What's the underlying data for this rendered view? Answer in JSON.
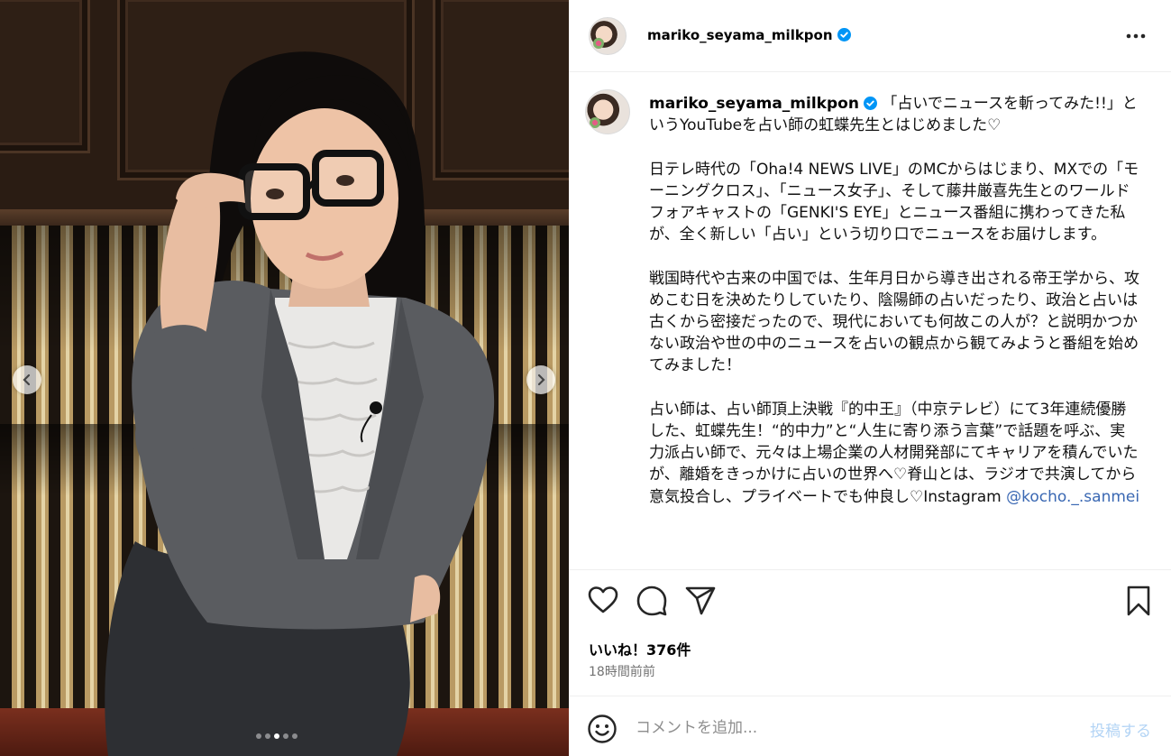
{
  "post": {
    "username": "mariko_seyama_milkpon",
    "verified": true,
    "caption_paragraphs": [
      "「占いでニュースを斬ってみた!!」というYouTubeを占い師の虹蝶先生とはじめました♡",
      "日テレ時代の「Oha!4 NEWS LIVE」のMCからはじまり、MXでの「モーニングクロス」、「ニュース女子」、そして藤井厳喜先生とのワールドフォアキャストの「GENKI'S EYE」とニュース番組に携わってきた私が、全く新しい「占い」という切り口でニュースをお届けします。",
      "戦国時代や古来の中国では、生年月日から導き出される帝王学から、攻めこむ日を決めたりしていたり、陰陽師の占いだったり、政治と占いは古くから密接だったので、現代においても何故この人が？と説明かつかない政治や世の中のニュースを占いの観点から観てみようと番組を始めてみました！",
      "占い師は、占い師頂上決戦『的中王』（中京テレビ）にて3年連続優勝した、虹蝶先生！“的中力”と“人生に寄り添う言葉”で話題を呼ぶ、実力派占い師で、元々は上場企業の人材開発部にてキャリアを積んでいたが、離婚をきっかけに占いの世界へ♡脊山とは、ラジオで共演してから意気投合し、プライベートでも仲良し♡Instagram "
    ],
    "mention": "@kocho._.sanmei",
    "likes": "いいね！376件",
    "time_ago": "18時間前前",
    "carousel": {
      "count": 5,
      "active_index": 2
    }
  },
  "comment": {
    "placeholder": "コメントを追加...",
    "post_label": "投稿する"
  },
  "icons": {
    "like": "heart-icon",
    "comment": "comment-icon",
    "share": "share-icon",
    "save": "bookmark-icon",
    "more": "more-icon",
    "emoji": "emoji-icon"
  },
  "colors": {
    "verified": "#0095f6",
    "mention": "#3a68b3",
    "post_button": "#b3d4f5",
    "muted": "#737373"
  }
}
